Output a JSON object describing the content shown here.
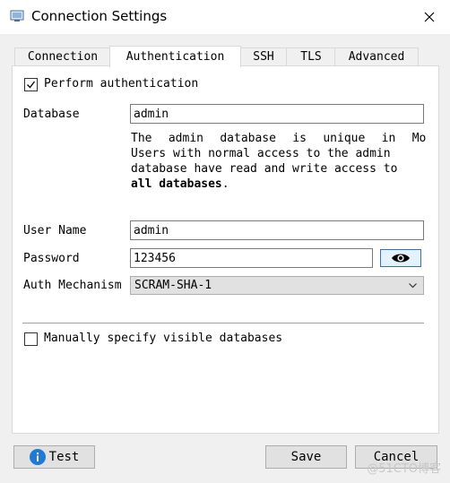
{
  "window": {
    "title": "Connection Settings"
  },
  "tabs": [
    {
      "label": "Connection"
    },
    {
      "label": "Authentication"
    },
    {
      "label": "SSH"
    },
    {
      "label": "TLS"
    },
    {
      "label": "Advanced"
    }
  ],
  "auth": {
    "perform_label": "Perform authentication",
    "perform_checked": true,
    "database_label": "Database",
    "database_value": "admin",
    "description": {
      "line1": [
        "The",
        "admin",
        "database",
        "is",
        "unique",
        "in",
        "Mong"
      ],
      "line2": "Users with normal access to the admin",
      "line3": "database have read and write access to",
      "line4": "all databases",
      "line4_end": "."
    },
    "username_label": "User Name",
    "username_value": "admin",
    "password_label": "Password",
    "password_value": "123456",
    "mechanism_label": "Auth Mechanism",
    "mechanism_value": "SCRAM-SHA-1",
    "visible_db_label": "Manually specify visible databases",
    "visible_db_checked": false
  },
  "footer": {
    "test_label": "Test",
    "save_label": "Save",
    "cancel_label": "Cancel"
  },
  "watermark": "@51CTO博客",
  "colors": {
    "accent": "#2f6fd0",
    "info_icon": "#1f7ad6"
  }
}
